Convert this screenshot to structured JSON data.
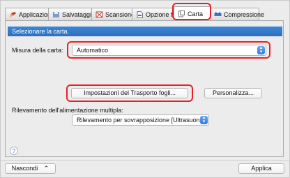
{
  "tabs": [
    {
      "label": "Applicazione",
      "icon": "pencil-icon"
    },
    {
      "label": "Salvataggio",
      "icon": "save-icon"
    },
    {
      "label": "Scansione",
      "icon": "scan-icon"
    },
    {
      "label": "Opzione file",
      "icon": "file-icon"
    },
    {
      "label": "Carta",
      "icon": "paper-icon"
    },
    {
      "label": "Compressione",
      "icon": "compression-icon"
    }
  ],
  "active_tab": "Carta",
  "banner": "Selezionare la carta.",
  "paper_size": {
    "label": "Misura della carta:",
    "value": "Automatico"
  },
  "transport_button": "Impostazioni del Trasporto fogli...",
  "customize_button": "Personalizza...",
  "multifeed": {
    "label": "Rilevamento dell'alimentazione multipla:",
    "value": "Rilevamento per sovrapposizione [Ultrasuoni]"
  },
  "help_icon": "?",
  "hide_button": "Nascondi",
  "apply_button": "Applica",
  "colors": {
    "accent": "#2f6fbf",
    "highlight": "#e8202a"
  }
}
